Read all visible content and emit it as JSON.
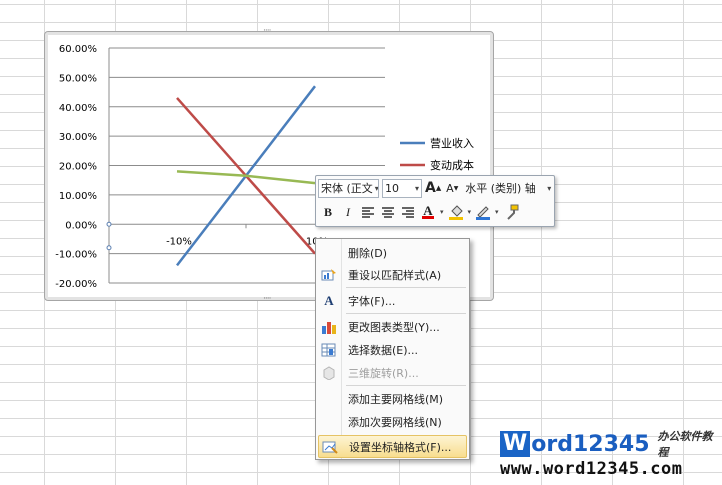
{
  "chart_data": {
    "type": "line",
    "x_tick_labels": [
      "-10%",
      "10%"
    ],
    "x": [
      -10,
      0,
      10
    ],
    "series": [
      {
        "name": "营业收入",
        "color": "#4a7ebb",
        "values": [
          -14,
          16.5,
          47
        ]
      },
      {
        "name": "变动成本",
        "color": "#be4b48",
        "values": [
          43,
          16.5,
          -10
        ]
      },
      {
        "name": "",
        "color": "#98b954",
        "values": [
          18,
          16.5,
          14
        ]
      }
    ],
    "y_tick_labels": [
      "60.00%",
      "50.00%",
      "40.00%",
      "30.00%",
      "20.00%",
      "10.00%",
      "0.00%",
      "-10.00%",
      "-20.00%"
    ],
    "ylim": [
      -20,
      60
    ],
    "grid": "horizontal",
    "legend_position": "right"
  },
  "mini_toolbar": {
    "font_name": "宋体 (正文",
    "font_size": "10",
    "grow_font": "A",
    "shrink_font": "A",
    "element_selector": "水平 (类别) 轴",
    "bold": "B",
    "italic": "I",
    "font_color_letter": "A"
  },
  "context_menu": {
    "items": [
      {
        "label": "删除(D)",
        "icon": "none"
      },
      {
        "label": "重设以匹配样式(A)",
        "icon": "reset-style-icon"
      },
      {
        "label": "字体(F)...",
        "icon": "font-icon"
      },
      {
        "label": "更改图表类型(Y)...",
        "icon": "chart-type-icon"
      },
      {
        "label": "选择数据(E)...",
        "icon": "select-data-icon"
      },
      {
        "label": "三维旋转(R)...",
        "icon": "3d-rotation-icon"
      },
      {
        "label": "添加主要网格线(M)",
        "icon": "none"
      },
      {
        "label": "添加次要网格线(N)",
        "icon": "none"
      },
      {
        "label": "设置坐标轴格式(F)...",
        "icon": "format-axis-icon"
      }
    ]
  },
  "watermark": {
    "brand_letter": "W",
    "brand_rest": "ord12345",
    "subtitle": "办公软件教程",
    "url": "www.word12345.com"
  }
}
